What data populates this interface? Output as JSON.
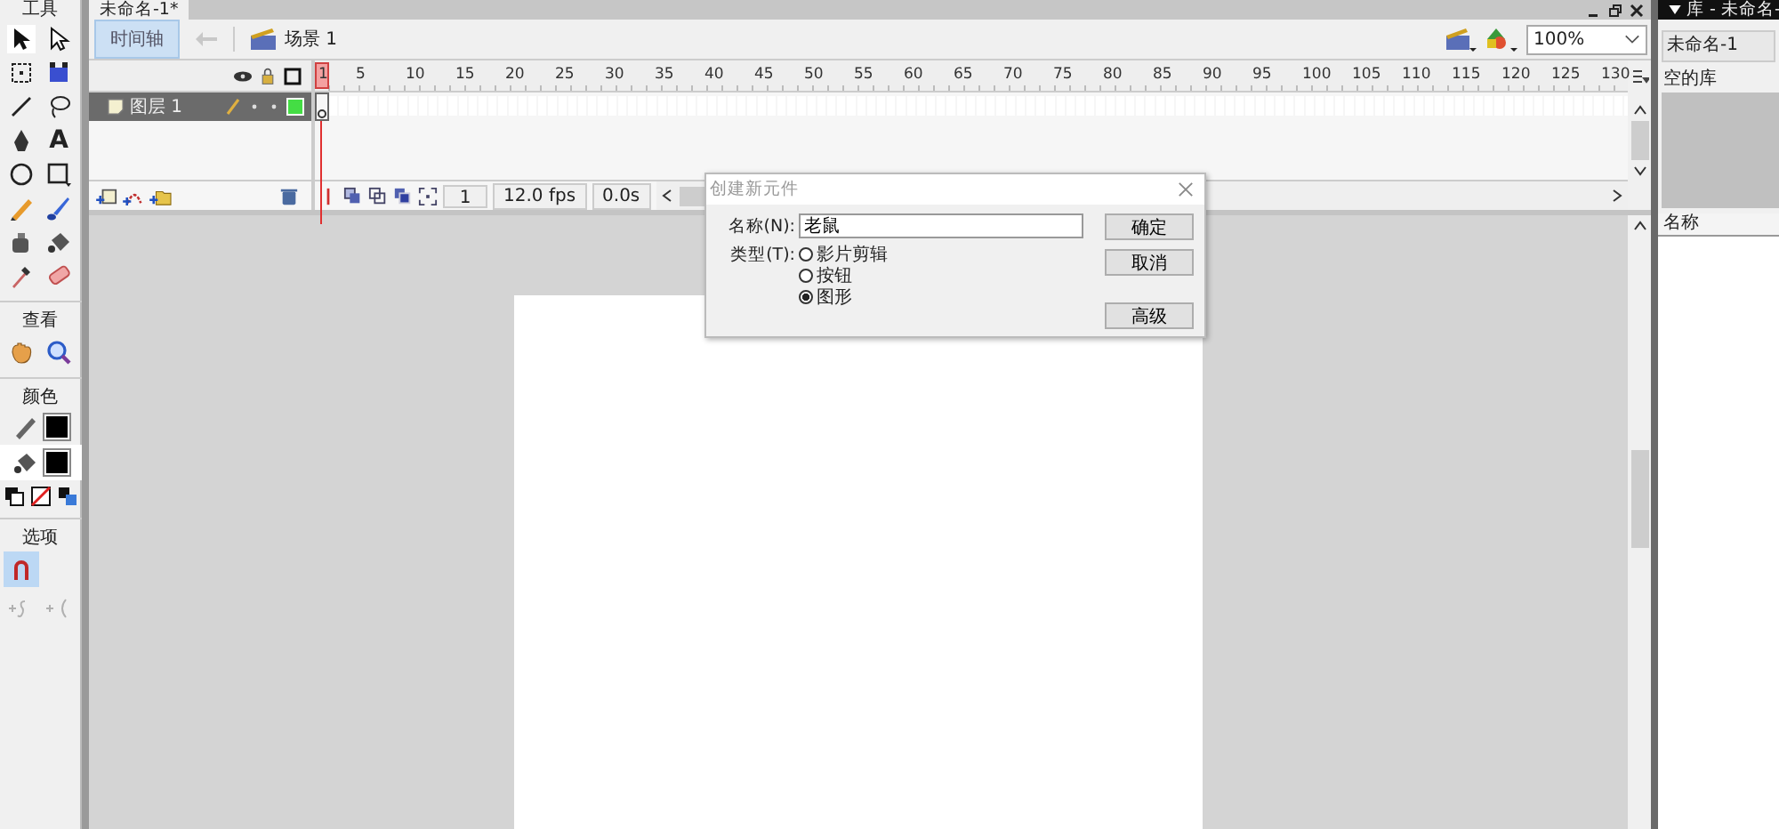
{
  "toolbox": {
    "title": "工具",
    "text_tool_glyph": "A",
    "view_label": "查看",
    "colors_label": "颜色",
    "options_label": "选项",
    "snap_selected": true
  },
  "document_tab": {
    "label": "未命名-1*",
    "selected": true
  },
  "edit_bar": {
    "timeline_button": {
      "label": "时间轴",
      "selected": true
    },
    "scene": "场景 1",
    "zoom": "100%"
  },
  "timeline": {
    "ruler": [
      "1",
      "5",
      "10",
      "15",
      "20",
      "25",
      "30",
      "35",
      "40",
      "45",
      "50",
      "55",
      "60",
      "65",
      "70",
      "75",
      "80",
      "85",
      "90",
      "95",
      "100",
      "105",
      "110",
      "115",
      "120",
      "125",
      "130"
    ],
    "layers": [
      {
        "name": "图层 1",
        "selected": true
      }
    ],
    "current_frame": "1",
    "frame_rate": "12.0 fps",
    "elapsed": "0.0s"
  },
  "dialog": {
    "title": "创建新元件",
    "name_label": "名称(N):",
    "name_value": "老鼠",
    "type_label": "类型(T):",
    "types": [
      {
        "label": "影片剪辑",
        "selected": false
      },
      {
        "label": "按钮",
        "selected": false
      },
      {
        "label": "图形",
        "selected": true
      }
    ],
    "buttons": [
      {
        "label": "确定"
      },
      {
        "label": "取消"
      },
      {
        "label": "高级"
      }
    ]
  },
  "library": {
    "title": "库 - 未命名-",
    "document": "未命名-1",
    "status": "空的库",
    "column": "名称"
  }
}
